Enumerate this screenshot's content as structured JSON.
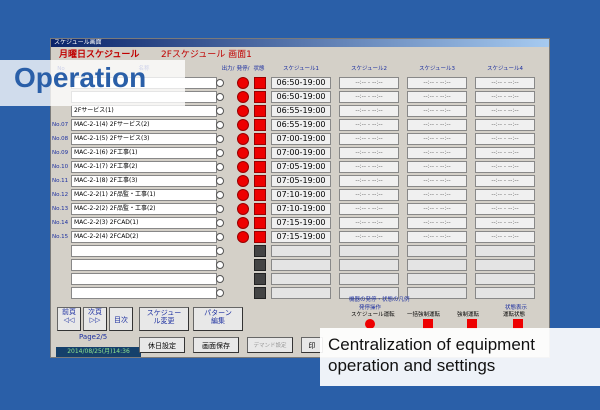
{
  "window": {
    "title": "スケジュール画面"
  },
  "header": {
    "day_title": "月曜日スケジュール",
    "screen_title": "2Fスケジュール 画面1"
  },
  "columns": {
    "no": "No",
    "name": "名称",
    "output": "出力/",
    "run": "発停/",
    "state": "状態",
    "sched1": "スケジュール1",
    "sched2": "スケジュール2",
    "sched3": "スケジュール3",
    "sched4": "スケジュール4"
  },
  "rows": [
    {
      "no": "",
      "name": "",
      "time": "06:50-19:00",
      "active": true
    },
    {
      "no": "",
      "name": "",
      "time": "06:50-19:00",
      "active": true
    },
    {
      "no": "",
      "name": "2Fサービス(1)",
      "time": "06:55-19:00",
      "active": true
    },
    {
      "no": "No.07",
      "name": "MAC-2-1(4) 2Fサービス(2)",
      "time": "06:55-19:00",
      "active": true
    },
    {
      "no": "No.08",
      "name": "MAC-2-1(5) 2Fサービス(3)",
      "time": "07:00-19:00",
      "active": true
    },
    {
      "no": "No.09",
      "name": "MAC-2-1(6) 2F工事(1)",
      "time": "07:00-19:00",
      "active": true
    },
    {
      "no": "No.10",
      "name": "MAC-2-1(7) 2F工事(2)",
      "time": "07:05-19:00",
      "active": true
    },
    {
      "no": "No.11",
      "name": "MAC-2-1(8) 2F工事(3)",
      "time": "07:05-19:00",
      "active": true
    },
    {
      "no": "No.12",
      "name": "MAC-2-2(1) 2F品監・工事(1)",
      "time": "07:10-19:00",
      "active": true
    },
    {
      "no": "No.13",
      "name": "MAC-2-2(2) 2F品監・工事(2)",
      "time": "07:10-19:00",
      "active": true
    },
    {
      "no": "No.14",
      "name": "MAC-2-2(3) 2FCAD(1)",
      "time": "07:15-19:00",
      "active": true
    },
    {
      "no": "No.15",
      "name": "MAC-2-2(4) 2FCAD(2)",
      "time": "07:15-19:00",
      "active": true
    },
    {
      "no": "",
      "name": "",
      "time": "",
      "active": false
    },
    {
      "no": "",
      "name": "",
      "time": "",
      "active": false
    },
    {
      "no": "",
      "name": "",
      "time": "",
      "active": false
    },
    {
      "no": "",
      "name": "",
      "time": "",
      "active": false
    }
  ],
  "empty_slot": "--:-- - --:--",
  "nav": {
    "prev": "前頁",
    "next": "次頁",
    "index": "目次",
    "page": "Page2/5",
    "schedule_change": "スケジュール変更",
    "pattern_edit": "パターン編集",
    "holiday": "休日設定",
    "save_screen": "画面保存",
    "demand": "デマンド設定",
    "print": "印"
  },
  "clock": "2014/08/25(月)14:36",
  "legend": {
    "title": "機器の発停・状態の凡例",
    "op_label": "発停操作",
    "sched_run": "スケジュール運転",
    "batch_run": "一括強制運転",
    "force_run": "強制運転",
    "state_label": "状態表示",
    "running": "運転状態"
  },
  "overlay": {
    "operation": "Operation",
    "caption": "Centralization of equipment operation and settings"
  }
}
